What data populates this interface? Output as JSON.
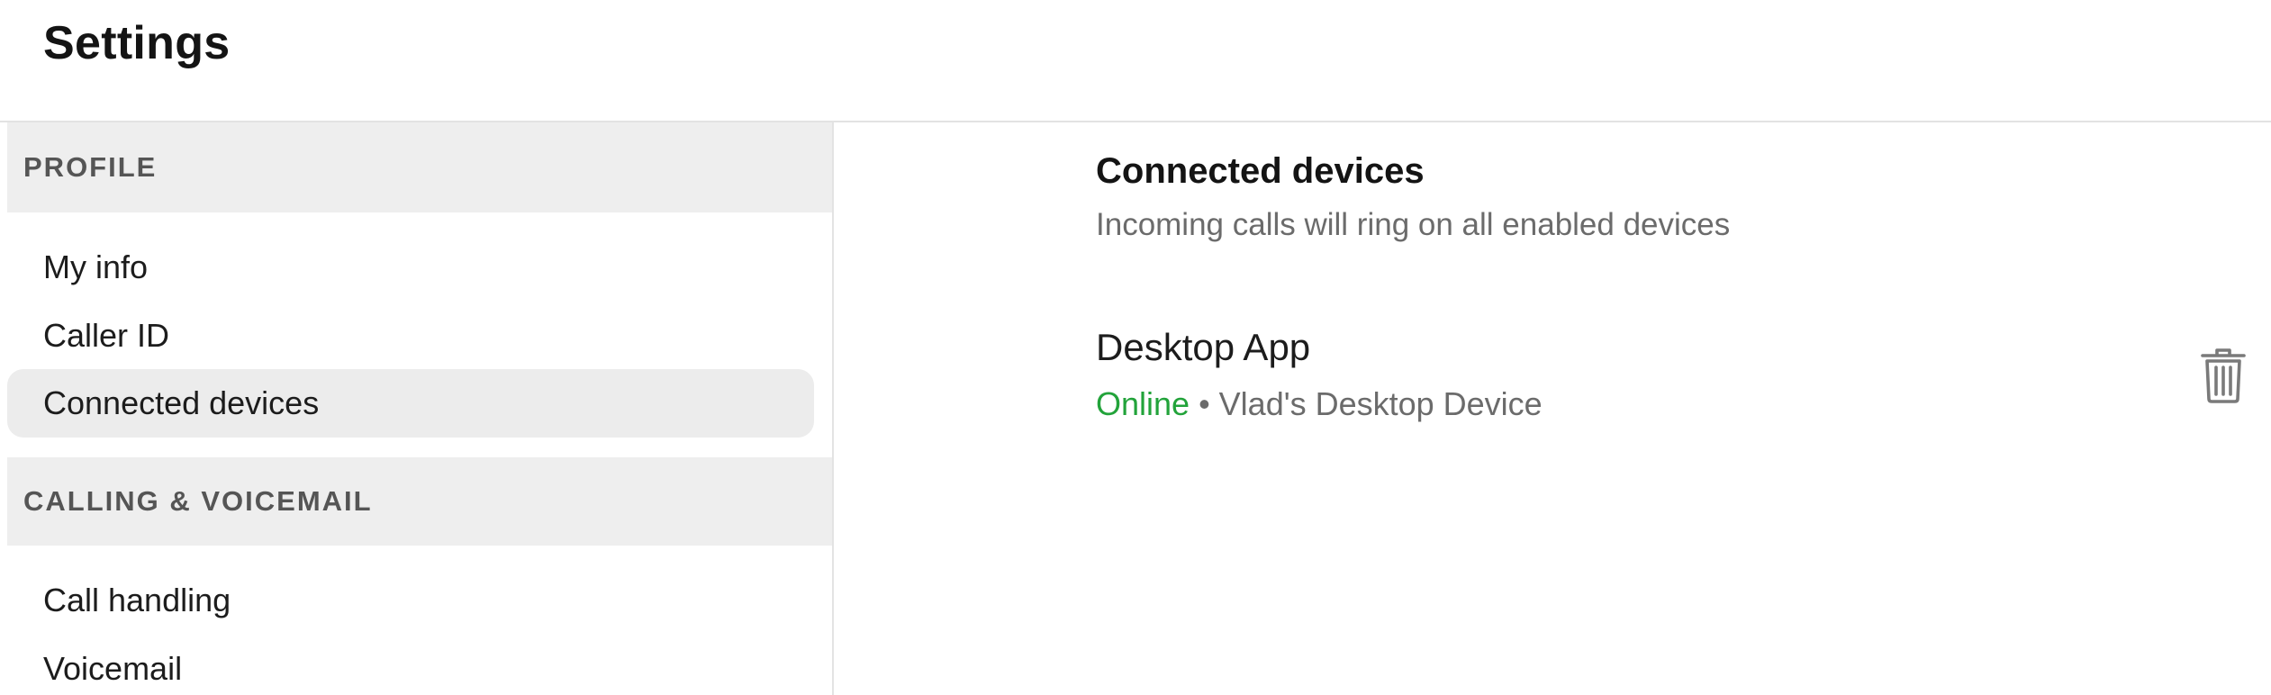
{
  "header": {
    "title": "Settings"
  },
  "sidebar": {
    "sections": [
      {
        "title": "PROFILE",
        "items": [
          {
            "label": "My info",
            "active": false
          },
          {
            "label": "Caller ID",
            "active": false
          },
          {
            "label": "Connected devices",
            "active": true
          }
        ]
      },
      {
        "title": "CALLING & VOICEMAIL",
        "items": [
          {
            "label": "Call handling",
            "active": false
          },
          {
            "label": "Voicemail",
            "active": false
          }
        ]
      }
    ]
  },
  "main": {
    "title": "Connected devices",
    "subtitle": "Incoming calls will ring on all enabled devices",
    "devices": [
      {
        "name": "Desktop App",
        "status": "Online",
        "separator": "•",
        "description": "Vlad's Desktop Device",
        "delete_icon": "trash-icon"
      }
    ]
  },
  "colors": {
    "online": "#22a33a",
    "section_bg": "#eeeeee",
    "active_bg": "#ececec",
    "muted_text": "#6b6b6b"
  }
}
